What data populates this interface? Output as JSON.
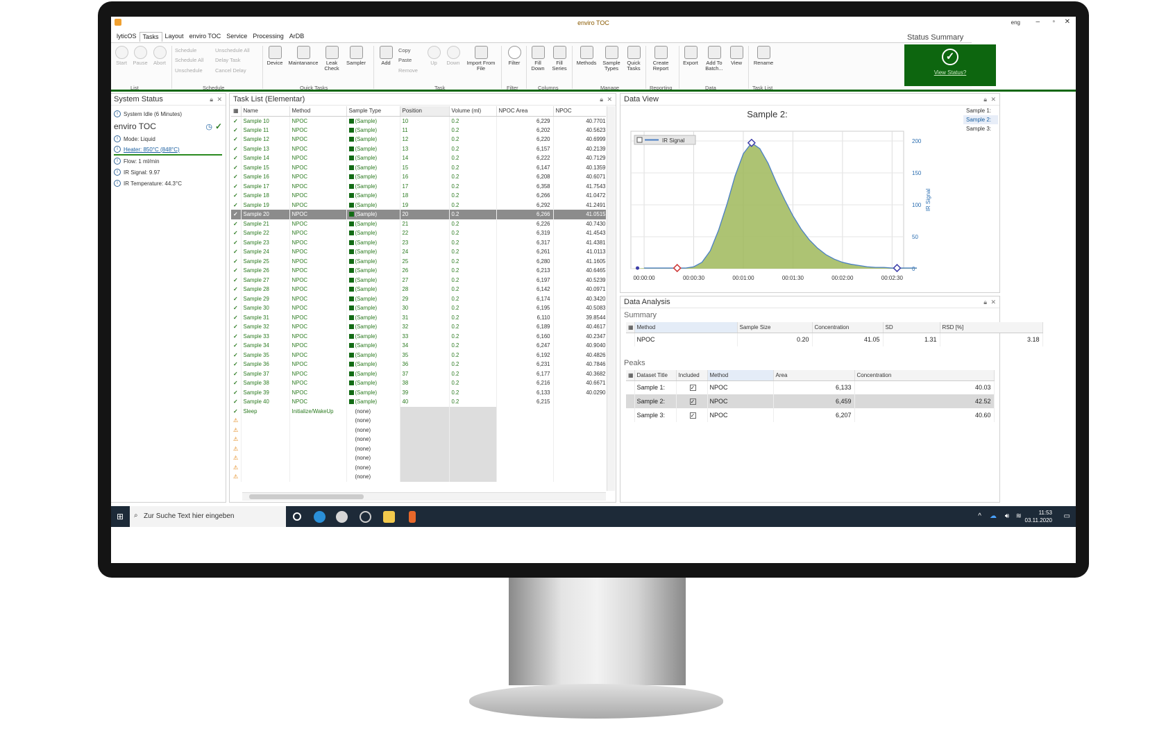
{
  "window": {
    "title": "enviro TOC",
    "lang": "eng"
  },
  "tabs": [
    "lyticOS",
    "Tasks",
    "Layout",
    "enviro TOC",
    "Service",
    "Processing",
    "ArDB"
  ],
  "ribbon": {
    "list": {
      "start": "Start",
      "pause": "Pause",
      "abort": "Abort",
      "group": "List"
    },
    "schedule": {
      "schedule": "Schedule",
      "schedule_all": "Schedule All",
      "unschedule": "Unschedule",
      "unschedule_all": "Unschedule All",
      "delay_task": "Delay Task",
      "cancel_delay": "Cancel Delay",
      "group": "Schedule"
    },
    "quick_tasks": {
      "device": "Device",
      "maintanance": "Maintanance",
      "leak_check": "Leak Check",
      "sampler": "Sampler",
      "group": "Quick Tasks"
    },
    "task": {
      "add": "Add",
      "copy": "Copy",
      "paste": "Paste",
      "remove": "Remove",
      "up": "Up",
      "down": "Down",
      "import": "Import From File",
      "group": "Task"
    },
    "filter": {
      "filter": "Filter",
      "group": "Filter"
    },
    "columns": {
      "fill_down": "Fill Down",
      "fill_series": "Fill Series",
      "group": "Columns"
    },
    "manage": {
      "methods": "Methods",
      "sample_types": "Sample Types",
      "quick_tasks": "Quick Tasks",
      "group": "Manage"
    },
    "reporting": {
      "create_report": "Create Report",
      "group": "Reporting"
    },
    "data": {
      "export": "Export",
      "add_to_batch": "Add To Batch...",
      "view": "View",
      "group": "Data"
    },
    "task_list": {
      "rename": "Rename",
      "group": "Task List"
    }
  },
  "status_summary": {
    "title": "Status Summary",
    "link": "View Status?",
    "color": "#0d660f"
  },
  "system_status": {
    "title": "System Status",
    "idle": "System Idle (6 Minutes)",
    "device": "enviro TOC",
    "items": [
      "Mode: Liquid",
      "Heater: 850°C (848°C)",
      "Flow: 1 ml/min",
      "IR Signal: 9.97",
      "IR Temperature: 44.3°C"
    ]
  },
  "task_list": {
    "title": "Task List (Elementar)",
    "columns": [
      "Name",
      "Method",
      "Sample Type",
      "Position",
      "Volume (ml)",
      "NPOC Area",
      "NPOC"
    ],
    "sample_type": "(Sample)",
    "rows": [
      [
        "Sample 10",
        "NPOC",
        "10",
        "0.2",
        "6,229",
        "40.7701"
      ],
      [
        "Sample 11",
        "NPOC",
        "11",
        "0.2",
        "6,202",
        "40.5623"
      ],
      [
        "Sample 12",
        "NPOC",
        "12",
        "0.2",
        "6,220",
        "40.6999"
      ],
      [
        "Sample 13",
        "NPOC",
        "13",
        "0.2",
        "6,157",
        "40.2139"
      ],
      [
        "Sample 14",
        "NPOC",
        "14",
        "0.2",
        "6,222",
        "40.7129"
      ],
      [
        "Sample 15",
        "NPOC",
        "15",
        "0.2",
        "6,147",
        "40.1359"
      ],
      [
        "Sample 16",
        "NPOC",
        "16",
        "0.2",
        "6,208",
        "40.6071"
      ],
      [
        "Sample 17",
        "NPOC",
        "17",
        "0.2",
        "6,358",
        "41.7543"
      ],
      [
        "Sample 18",
        "NPOC",
        "18",
        "0.2",
        "6,266",
        "41.0472"
      ],
      [
        "Sample 19",
        "NPOC",
        "19",
        "0.2",
        "6,292",
        "41.2491"
      ],
      [
        "Sample 20",
        "NPOC",
        "20",
        "0.2",
        "6,266",
        "41.0515"
      ],
      [
        "Sample 21",
        "NPOC",
        "21",
        "0.2",
        "6,226",
        "40.7430"
      ],
      [
        "Sample 22",
        "NPOC",
        "22",
        "0.2",
        "6,319",
        "41.4543"
      ],
      [
        "Sample 23",
        "NPOC",
        "23",
        "0.2",
        "6,317",
        "41.4381"
      ],
      [
        "Sample 24",
        "NPOC",
        "24",
        "0.2",
        "6,261",
        "41.0113"
      ],
      [
        "Sample 25",
        "NPOC",
        "25",
        "0.2",
        "6,280",
        "41.1605"
      ],
      [
        "Sample 26",
        "NPOC",
        "26",
        "0.2",
        "6,213",
        "40.6465"
      ],
      [
        "Sample 27",
        "NPOC",
        "27",
        "0.2",
        "6,197",
        "40.5239"
      ],
      [
        "Sample 28",
        "NPOC",
        "28",
        "0.2",
        "6,142",
        "40.0971"
      ],
      [
        "Sample 29",
        "NPOC",
        "29",
        "0.2",
        "6,174",
        "40.3420"
      ],
      [
        "Sample 30",
        "NPOC",
        "30",
        "0.2",
        "6,195",
        "40.5083"
      ],
      [
        "Sample 31",
        "NPOC",
        "31",
        "0.2",
        "6,110",
        "39.8544"
      ],
      [
        "Sample 32",
        "NPOC",
        "32",
        "0.2",
        "6,189",
        "40.4617"
      ],
      [
        "Sample 33",
        "NPOC",
        "33",
        "0.2",
        "6,160",
        "40.2347"
      ],
      [
        "Sample 34",
        "NPOC",
        "34",
        "0.2",
        "6,247",
        "40.9040"
      ],
      [
        "Sample 35",
        "NPOC",
        "35",
        "0.2",
        "6,192",
        "40.4826"
      ],
      [
        "Sample 36",
        "NPOC",
        "36",
        "0.2",
        "6,231",
        "40.7846"
      ],
      [
        "Sample 37",
        "NPOC",
        "37",
        "0.2",
        "6,177",
        "40.3682"
      ],
      [
        "Sample 38",
        "NPOC",
        "38",
        "0.2",
        "6,216",
        "40.6671"
      ],
      [
        "Sample 39",
        "NPOC",
        "39",
        "0.2",
        "6,133",
        "40.0290"
      ],
      [
        "Sample 40",
        "NPOC",
        "40",
        "0.2",
        "6,215",
        ""
      ]
    ],
    "selected_row": 10,
    "sleep": {
      "name": "Sleep",
      "method": "Initialize/WakeUp",
      "type": "(none)"
    },
    "empty_type": "(none)",
    "empty_rows": 7
  },
  "data_view": {
    "title": "Data View",
    "chart_title": "Sample 2:",
    "legend": "IR Signal",
    "ylabel": "IR Signal",
    "samples": [
      "Sample 1:",
      "Sample 2:",
      "Sample 3:"
    ],
    "active_sample": 1,
    "xticks": [
      "00:00:00",
      "00:00:30",
      "00:01:00",
      "00:01:30",
      "00:02:00",
      "00:02:30"
    ],
    "yticks": [
      "200",
      "150",
      "100",
      "50",
      "0"
    ]
  },
  "chart_data": {
    "type": "area",
    "title": "Sample 2:",
    "ylabel": "IR Signal",
    "ylim": [
      0,
      200
    ],
    "xlim": [
      0,
      165
    ],
    "series": [
      {
        "name": "IR Signal",
        "x": [
          0,
          10,
          20,
          25,
          30,
          35,
          40,
          45,
          50,
          55,
          60,
          65,
          70,
          75,
          80,
          85,
          90,
          95,
          100,
          105,
          110,
          115,
          120,
          125,
          130,
          135,
          140,
          145,
          150,
          155,
          160,
          165
        ],
        "y": [
          1,
          1,
          1,
          1,
          3,
          10,
          28,
          60,
          100,
          145,
          180,
          197,
          188,
          165,
          135,
          108,
          83,
          62,
          45,
          32,
          22,
          15,
          10,
          7,
          5,
          3,
          2,
          2,
          1,
          1,
          1,
          1
        ]
      }
    ],
    "markers": [
      {
        "x": 20,
        "y": 1
      },
      {
        "x": 65,
        "y": 197
      },
      {
        "x": 153,
        "y": 1
      }
    ]
  },
  "data_analysis": {
    "title": "Data Analysis",
    "summary_label": "Summary",
    "summary_cols": [
      "Method",
      "Sample Size",
      "Concentration",
      "SD",
      "RSD [%]"
    ],
    "summary_row": [
      "NPOC",
      "0.20",
      "41.05",
      "1.31",
      "3.18"
    ],
    "peaks_label": "Peaks",
    "peaks_cols": [
      "Dataset Title",
      "Included",
      "Method",
      "Area",
      "Concentration"
    ],
    "peaks": [
      [
        "Sample 1:",
        "NPOC",
        "6,133",
        "40.03"
      ],
      [
        "Sample 2:",
        "NPOC",
        "6,459",
        "42.52"
      ],
      [
        "Sample 3:",
        "NPOC",
        "6,207",
        "40.60"
      ]
    ]
  },
  "taskbar": {
    "search": "Zur Suche Text hier eingeben",
    "time": "11:53",
    "date": "03.11.2020"
  }
}
